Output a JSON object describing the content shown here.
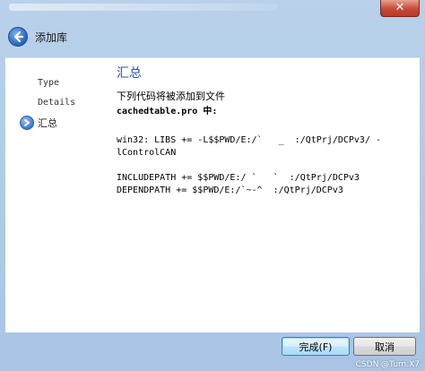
{
  "window": {
    "close_label": "✕"
  },
  "header": {
    "title": "添加库"
  },
  "sidebar": {
    "items": [
      {
        "label": "Type"
      },
      {
        "label": "Details"
      },
      {
        "label": "汇总"
      }
    ]
  },
  "main": {
    "section_title": "汇总",
    "intro": "下列代码将被添加到文件",
    "file_line": "cachedtable.pro 中:",
    "code_lines": [
      "win32: LIBS += -L$$PWD/E:/`   _  :/QtPrj/DCPv3/ -",
      "lControlCAN",
      "INCLUDEPATH += $$PWD/E:/ `   `  :/QtPrj/DCPv3",
      "DEPENDPATH += $$PWD/E:/`~-^  :/QtPrj/DCPv3"
    ]
  },
  "footer": {
    "finish_label": "完成(F)",
    "cancel_label": "取消"
  },
  "watermark": "CSDN @Turn.X7"
}
